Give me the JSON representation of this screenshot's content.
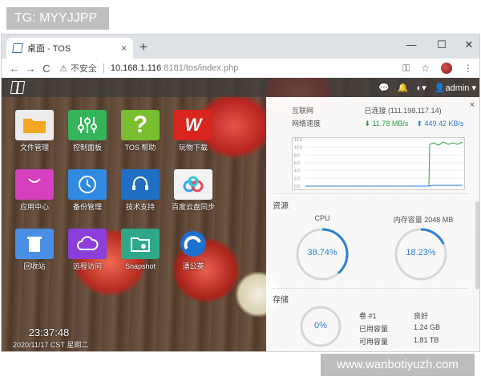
{
  "tags": {
    "top": "TG: MYYJJPP",
    "bottom": "www.wanbotiyuzh.com"
  },
  "browser": {
    "tab_title": "桌面 - TOS",
    "tab_close": "×",
    "new_tab": "+",
    "window_controls": {
      "minimize": "—",
      "maximize": "☐",
      "close": "✕"
    },
    "nav": {
      "back": "←",
      "forward": "→",
      "reload": "C"
    },
    "insecure_label": "不安全",
    "url_host": "10.168.1.116",
    "url_path": ":8181/tos/index.php",
    "icons": [
      "key-icon",
      "star-icon",
      "profile-avatar-icon",
      "more-icon"
    ]
  },
  "topbar": {
    "icons": [
      "chat-icon",
      "bell-icon",
      "globe-icon",
      "user-icon"
    ],
    "user": "admin"
  },
  "apps": [
    {
      "id": "files",
      "label": "文件管理",
      "icon": "folder-icon",
      "color": "#e9e9e9"
    },
    {
      "id": "control",
      "label": "控制面板",
      "icon": "sliders-icon",
      "color": "#35b45a"
    },
    {
      "id": "help",
      "label": "TOS 帮助",
      "icon": "question-icon",
      "color": "#79be2e"
    },
    {
      "id": "downloads",
      "label": "玩物下载",
      "icon": "wanwu-icon",
      "color": "#d9251f"
    },
    {
      "id": "appcenter",
      "label": "应用中心",
      "icon": "bag-icon",
      "color": "#d63fbd"
    },
    {
      "id": "backup",
      "label": "备份管理",
      "icon": "clock-backup-icon",
      "color": "#2f8ae0"
    },
    {
      "id": "support",
      "label": "技术支持",
      "icon": "headset-icon",
      "color": "#1f6fc4"
    },
    {
      "id": "baidu",
      "label": "百度云盘同步",
      "icon": "baidu-cloud-icon",
      "color": "#f3f3f3"
    },
    {
      "id": "recycle",
      "label": "回收站",
      "icon": "recycle-bin-icon",
      "color": "#4a8fe6"
    },
    {
      "id": "remote",
      "label": "远程访问",
      "icon": "cloud-icon",
      "color": "#8b3fd8"
    },
    {
      "id": "snapshot",
      "label": "Snapshot",
      "icon": "snapshot-icon",
      "color": "#2fa88a"
    },
    {
      "id": "yongguan",
      "label": "湧公英",
      "icon": "dandelion-icon",
      "color": "#1d6fd0"
    }
  ],
  "clock": {
    "time": "23:37:48",
    "date": "2020/11/17 CST 星期二"
  },
  "monitor": {
    "close": "×",
    "internet_label": "互联网",
    "internet_status": "已连接 (111.198.117.14)",
    "speed_label": "网络速度",
    "download": "11.78 MB/s",
    "upload": "449.42 KB/s",
    "chart_ticks": [
      "12.0",
      "10.0",
      "8.0",
      "6.0",
      "4.0",
      "2.0",
      "0.0"
    ],
    "resources_label": "资源",
    "cpu_label": "CPU",
    "cpu_value": "38.74%",
    "cpu_fraction": 0.3874,
    "mem_label": "内存容量 2048 MB",
    "mem_value": "18.23%",
    "mem_fraction": 0.1823,
    "storage_label": "存储",
    "storage_value": "0%",
    "storage_fraction": 0,
    "volume_name": "卷 #1",
    "volume_status": "良好",
    "used_label": "已用容量",
    "used_value": "1.24 GB",
    "avail_label": "可用容量",
    "avail_value": "1.81 TB",
    "colors": {
      "download": "#2e9e45",
      "upload": "#2c7fd6",
      "gauge": "#2c7fd6",
      "gauge_track": "#d6d6d6"
    }
  }
}
